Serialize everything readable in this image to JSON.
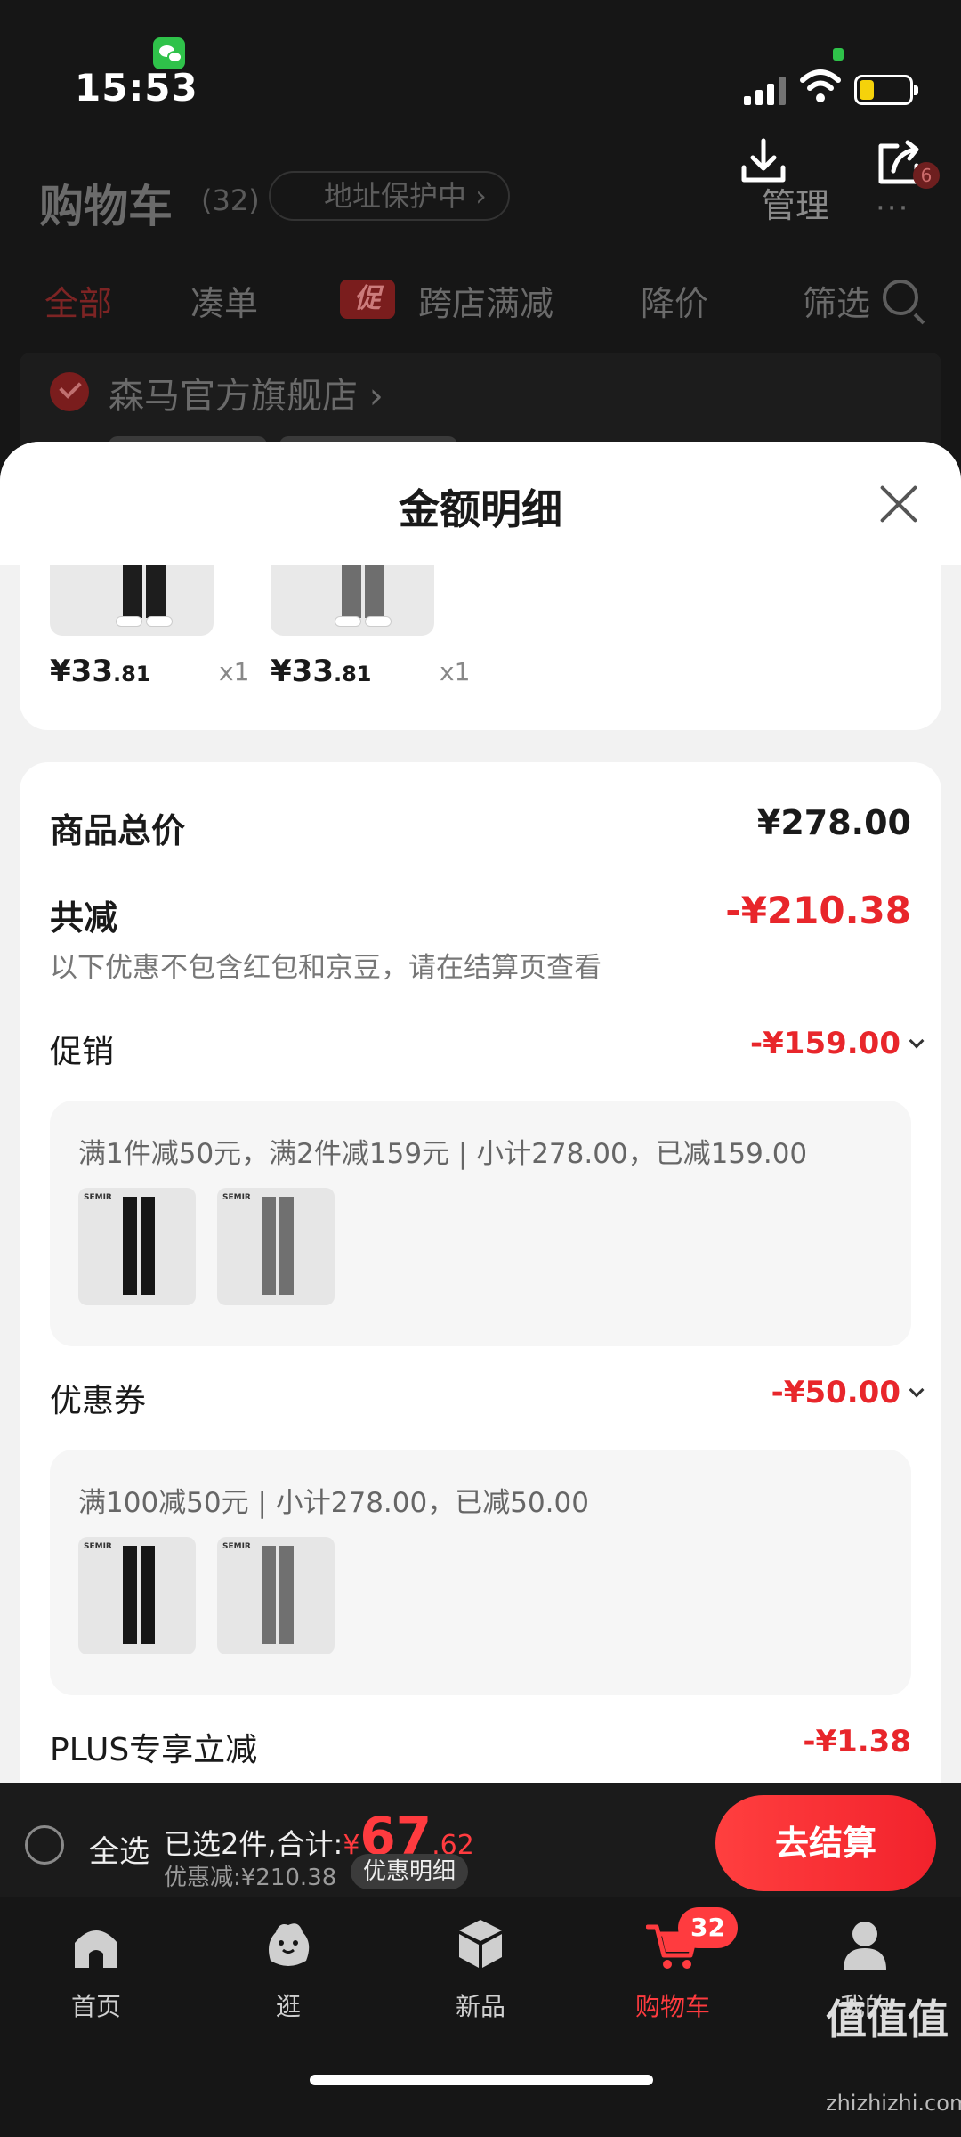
{
  "status_bar": {
    "time": "15:53"
  },
  "background": {
    "title": "购物车",
    "count": "(32)",
    "address_tag": "地址保护中 ›",
    "manage": "管理",
    "more": "···",
    "more_badge": "6",
    "tabs": [
      "全部",
      "凑单",
      "跨店满减",
      "降价",
      "筛选"
    ],
    "promo_tag": "促",
    "store_name": "森马官方旗舰店 ›"
  },
  "sheet": {
    "title": "金额明细",
    "products": [
      {
        "price_main": "¥33",
        "price_dec": ".81",
        "qty": "x1"
      },
      {
        "price_main": "¥33",
        "price_dec": ".81",
        "qty": "x1"
      }
    ],
    "total_label": "商品总价",
    "total_value": "¥278.00",
    "reduce_label": "共减",
    "reduce_value": "-¥210.38",
    "hint": "以下优惠不包含红包和京豆，请在结算页查看",
    "promo": {
      "label": "促销",
      "value": "-¥159.00",
      "desc": "满1件减50元，满2件减159元 | 小计278.00，已减159.00",
      "brand": "SEMIR"
    },
    "coupon": {
      "label": "优惠券",
      "value": "-¥50.00",
      "desc": "满100减50元 | 小计278.00，已减50.00",
      "brand": "SEMIR"
    },
    "plus": {
      "label": "PLUS专享立减",
      "value": "-¥1.38"
    }
  },
  "checkout": {
    "select_all": "全选",
    "selected_prefix": "已选2件,合计:",
    "currency": "¥",
    "amount_int": "67",
    "amount_dec": ".62",
    "discount": "优惠减:¥210.38",
    "detail_button": "优惠明细",
    "checkout_button": "去结算"
  },
  "tabbar": {
    "items": [
      {
        "label": "首页",
        "icon": "home-icon"
      },
      {
        "label": "逛",
        "icon": "stroll-icon"
      },
      {
        "label": "新品",
        "icon": "cube-icon"
      },
      {
        "label": "购物车",
        "icon": "cart-icon"
      },
      {
        "label": "我的",
        "icon": "profile-icon"
      }
    ],
    "cart_badge": "32"
  },
  "watermark": {
    "text": "值值值",
    "url": "zhizhizhi.com"
  },
  "colors": {
    "accent": "#e8262b",
    "background": "#161616",
    "sheet": "#f2f2f2"
  }
}
